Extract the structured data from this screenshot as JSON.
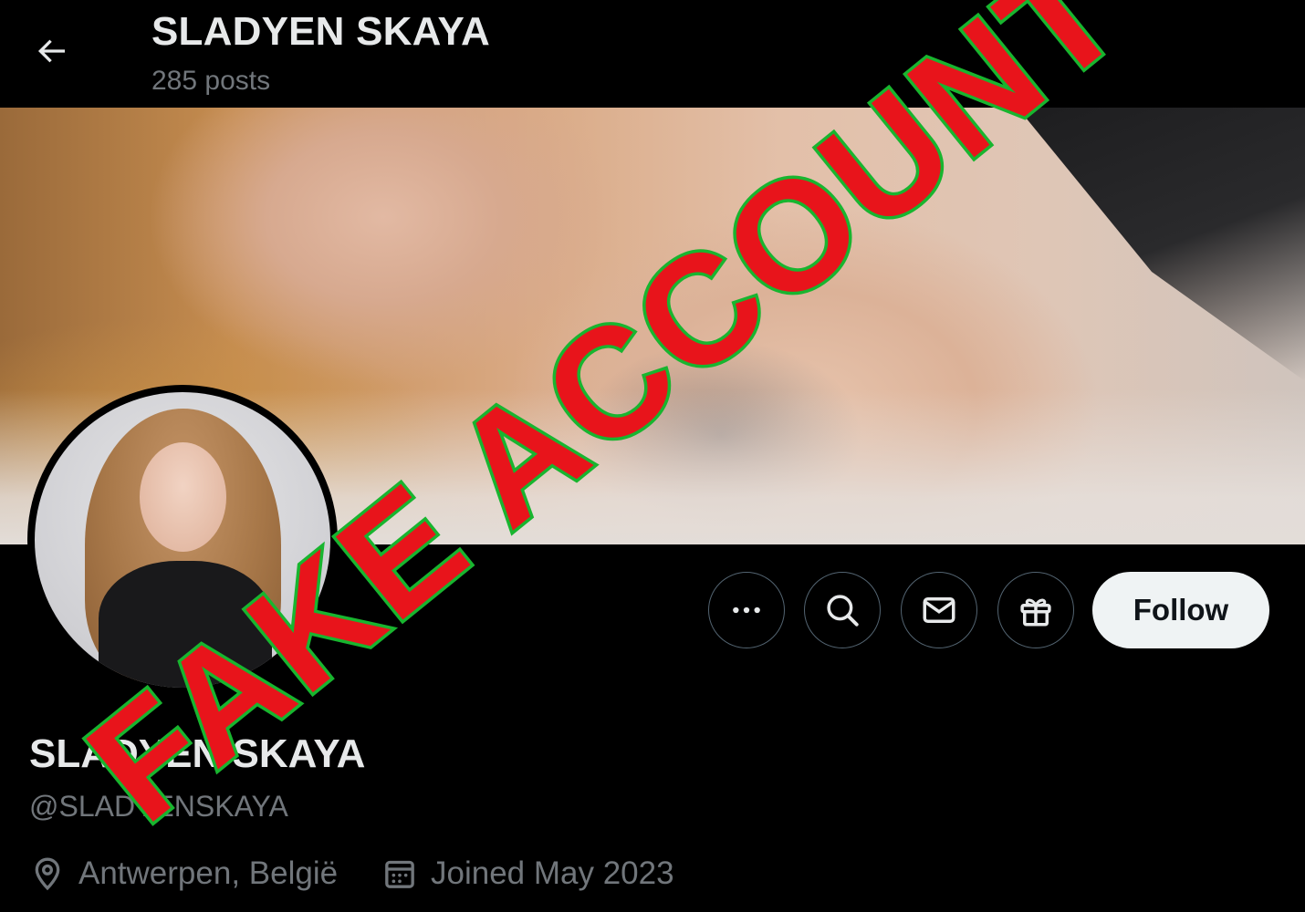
{
  "header": {
    "title": "SLADYEN SKAYA",
    "post_count": "285 posts",
    "back_icon": "arrow-left-icon"
  },
  "profile": {
    "display_name": "SLADYEN SKAYA",
    "handle": "@SLADYENSKAYA",
    "location": "Antwerpen, België",
    "joined": "Joined May 2023"
  },
  "actions": {
    "more_icon": "more-dots-icon",
    "search_icon": "search-icon",
    "message_icon": "envelope-icon",
    "gift_icon": "gift-icon",
    "follow_label": "Follow"
  },
  "overlay": {
    "stamp_text": "FAKE ACCOUNT",
    "stamp_fill": "#e8141b",
    "stamp_outline": "#18b52f"
  },
  "colors": {
    "background": "#000000",
    "primary_text": "#e7e9ea",
    "secondary_text": "#71767b",
    "button_border": "#536471",
    "follow_bg": "#eff3f4"
  }
}
